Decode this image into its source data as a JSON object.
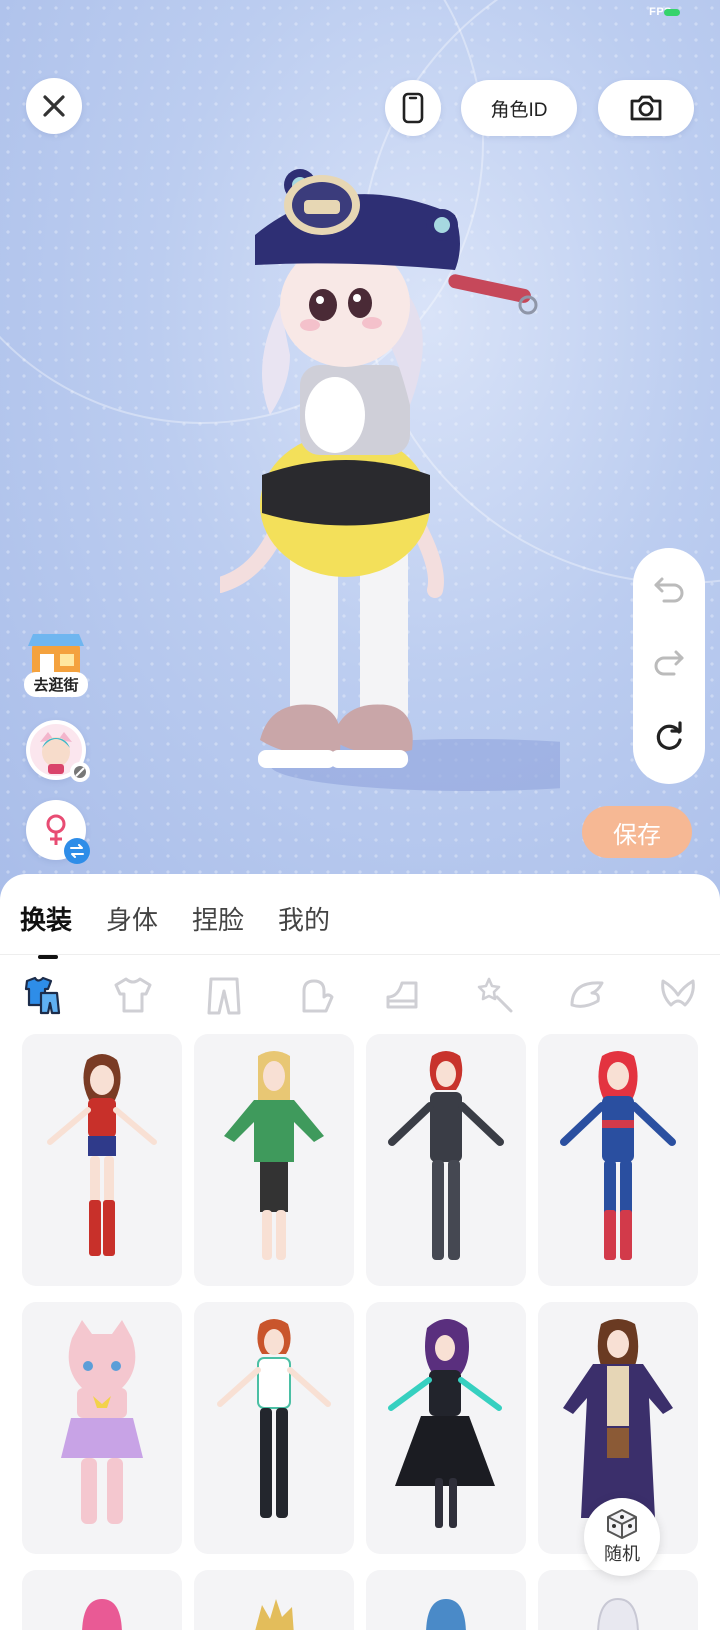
{
  "status_bar": {
    "fps_label": "FPS"
  },
  "top_bar": {
    "close_icon": "close-icon",
    "device_icon": "phone-icon",
    "role_id_label": "角色ID",
    "camera_icon": "camera-icon"
  },
  "left_panel": {
    "street_label": "去逛街",
    "gender_icon": "female-symbol-icon",
    "swap_icon": "swap-icon"
  },
  "right_panel": {
    "undo_icon": "undo-icon",
    "redo_icon": "redo-icon",
    "reset_icon": "reset-icon"
  },
  "save_label": "保存",
  "tabs": [
    {
      "label": "换装",
      "active": true
    },
    {
      "label": "身体",
      "active": false
    },
    {
      "label": "捏脸",
      "active": false
    },
    {
      "label": "我的",
      "active": false
    }
  ],
  "categories": [
    "outfit-set-icon",
    "top-icon",
    "pants-icon",
    "gloves-icon",
    "shoes-icon",
    "wand-icon",
    "wing-icon",
    "bow-icon"
  ],
  "random_label": "随机",
  "colors": {
    "accent": "#f6b894",
    "scene_bg": "#bccdf0",
    "selected_category": "#2e8de8"
  }
}
